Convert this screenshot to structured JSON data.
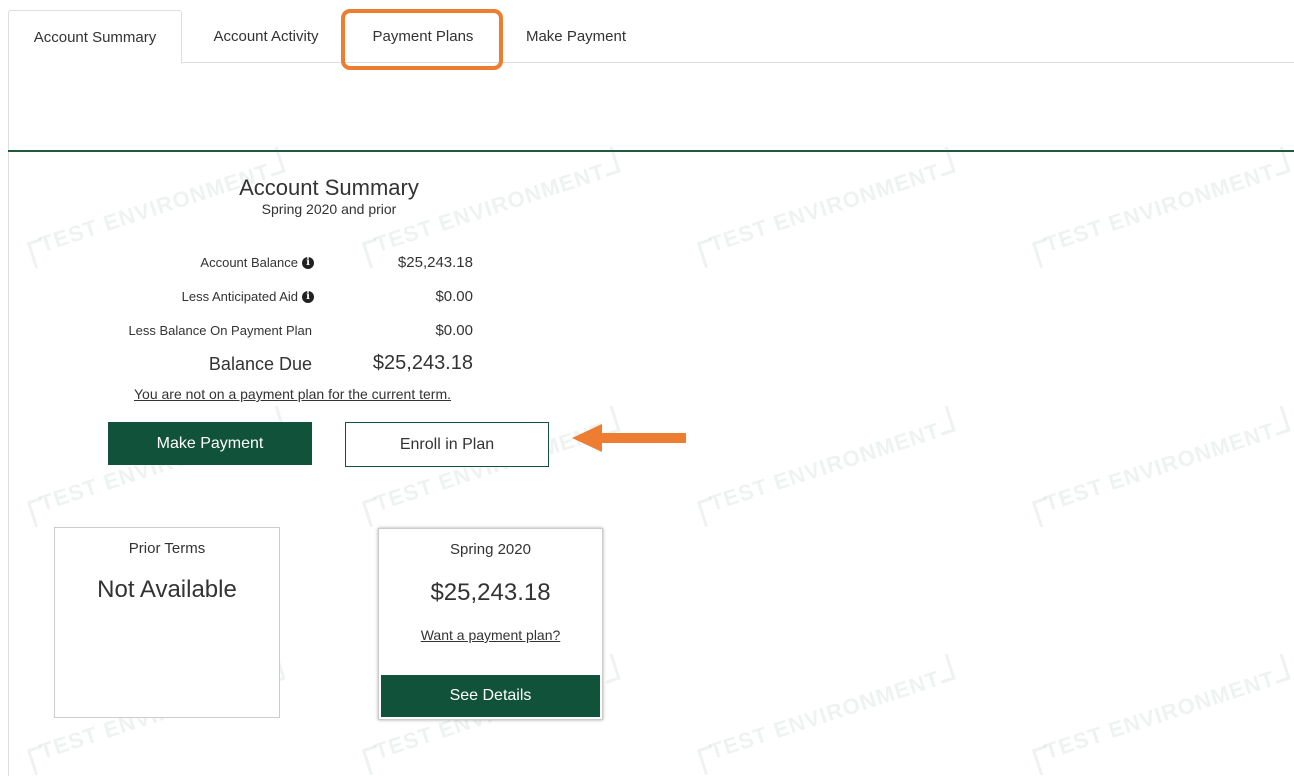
{
  "tabs": [
    {
      "label": "Account Summary",
      "active": true
    },
    {
      "label": "Account Activity",
      "active": false
    },
    {
      "label": "Payment Plans",
      "active": false,
      "highlighted": true
    },
    {
      "label": "Make Payment",
      "active": false
    }
  ],
  "watermark": {
    "text": "TEST ENVIRONMENT"
  },
  "summary": {
    "title": "Account Summary",
    "subtitle": "Spring 2020 and prior",
    "rows": [
      {
        "label": "Account Balance",
        "value": "$25,243.18",
        "info_icon": true
      },
      {
        "label": "Less Anticipated Aid",
        "value": "$0.00",
        "info_icon": true
      },
      {
        "label": "Less Balance On Payment Plan",
        "value": "$0.00",
        "info_icon": false
      }
    ],
    "balance_due": {
      "label": "Balance Due",
      "value": "$25,243.18"
    },
    "plan_link": "You are not on a payment plan for the current term.",
    "make_payment_label": "Make Payment",
    "enroll_label": "Enroll in Plan"
  },
  "cards": {
    "prior": {
      "heading": "Prior Terms",
      "value": "Not Available"
    },
    "spring": {
      "heading": "Spring 2020",
      "value": "$25,243.18",
      "link": "Want a payment plan?",
      "button": "See Details"
    }
  },
  "colors": {
    "brand_green": "#11533a",
    "highlight_orange": "#ed7d31",
    "divider_green": "#1e5b3e"
  },
  "icons": {
    "info": "info-circle-icon",
    "arrow": "arrow-left-icon"
  }
}
